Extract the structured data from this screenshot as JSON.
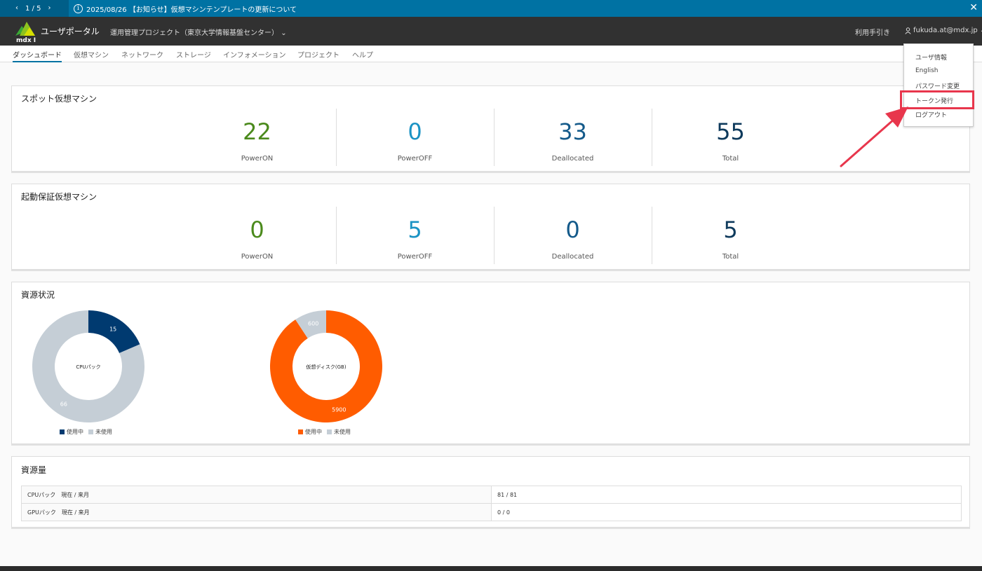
{
  "notice": {
    "pager": "1 / 5",
    "prev_icon": "‹",
    "next_icon": "›",
    "text": "2025/08/26 【お知らせ】仮想マシンテンプレートの更新について",
    "close": "✕"
  },
  "header": {
    "logo_text": "mdx I",
    "app_title": "ユーザポータル",
    "project": "運用管理プロジェクト（東京大学情報基盤センター）",
    "project_chevron": "⌄",
    "manual": "利用手引き",
    "user": "fukuda.at@mdx.jp",
    "user_chevron": "⌄"
  },
  "nav": {
    "tabs": [
      "ダッシュボード",
      "仮想マシン",
      "ネットワーク",
      "ストレージ",
      "インフォメーション",
      "プロジェクト",
      "ヘルプ"
    ]
  },
  "spot": {
    "title": "スポット仮想マシン",
    "stats": [
      {
        "value": "22",
        "label": "PowerON"
      },
      {
        "value": "0",
        "label": "PowerOFF"
      },
      {
        "value": "33",
        "label": "Deallocated"
      },
      {
        "value": "55",
        "label": "Total"
      }
    ]
  },
  "guaranteed": {
    "title": "起動保証仮想マシン",
    "stats": [
      {
        "value": "0",
        "label": "PowerON"
      },
      {
        "value": "5",
        "label": "PowerOFF"
      },
      {
        "value": "0",
        "label": "Deallocated"
      },
      {
        "value": "5",
        "label": "Total"
      }
    ]
  },
  "resources": {
    "title": "資源状況",
    "cpu": {
      "center": "CPUパック",
      "used": 15,
      "unused": 66,
      "used_label": "使用中",
      "unused_label": "未使用"
    },
    "disk": {
      "center": "仮想ディスク(GB)",
      "used": 5900,
      "unused": 600,
      "used_label": "使用中",
      "unused_label": "未使用"
    }
  },
  "amount": {
    "title": "資源量",
    "rows": [
      {
        "key": "CPUパック　現在 / 来月",
        "value": "81 / 81"
      },
      {
        "key": "GPUパック　現在 / 来月",
        "value": "0 / 0"
      }
    ]
  },
  "menu": {
    "items": [
      "ユーザ情報",
      "English",
      "パスワード変更",
      "トークン発行",
      "ログアウト"
    ]
  },
  "colors": {
    "accent": "#0072a3",
    "header": "#313131",
    "power_on": "#4b8a1c",
    "power_off": "#1b93c4",
    "deallocated": "#145a8a",
    "total": "#0e3a5c",
    "cpu_used": "#003a70",
    "disk_used": "#ff5c00",
    "unused": "#c5ced6",
    "highlight": "#e8364c"
  }
}
